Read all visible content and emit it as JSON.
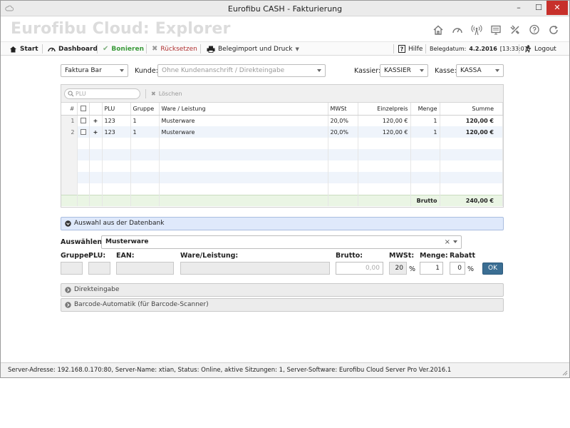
{
  "window": {
    "title": "Eurofibu CASH - Fakturierung",
    "min": "–",
    "max": "☐",
    "close": "✕"
  },
  "header": {
    "brand": "Eurofibu Cloud: Explorer"
  },
  "toolbar": {
    "start": "Start",
    "dashboard": "Dashboard",
    "bonieren": "Bonieren",
    "ruecksetzen": "Rücksetzen",
    "belegimport": "Belegimport und Druck",
    "hilfe": "Hilfe",
    "belegdatum_label": "Belegdatum:",
    "belegdatum_date": "4.2.2016",
    "belegdatum_time": "[13:33:07]",
    "logout": "Logout"
  },
  "form": {
    "type_value": "Faktura Bar",
    "kunde_label": "Kunde:",
    "kunde_placeholder": "Ohne Kundenanschrift / Direkteingabe",
    "kassier_label": "Kassier:",
    "kassier_value": "KASSIER",
    "kasse_label": "Kasse:",
    "kasse_value": "KASSA"
  },
  "grid": {
    "search_placeholder": "PLU",
    "clear_label": "Löschen",
    "columns": [
      "#",
      "",
      "PLU",
      "Gruppe",
      "Ware / Leistung",
      "MWSt",
      "Einzelpreis",
      "Menge",
      "Summe"
    ],
    "rows": [
      {
        "num": "1",
        "plus": "+",
        "plu": "123",
        "gruppe": "1",
        "ware": "Musterware",
        "mwst": "20,0%",
        "einzelpreis": "120,00 €",
        "menge": "1",
        "summe": "120,00 €"
      },
      {
        "num": "2",
        "plus": "+",
        "plu": "123",
        "gruppe": "1",
        "ware": "Musterware",
        "mwst": "20,0%",
        "einzelpreis": "120,00 €",
        "menge": "1",
        "summe": "120,00 €"
      }
    ],
    "footer_label": "Brutto",
    "footer_total": "240,00 €"
  },
  "selection": {
    "panel_title": "Auswahl aus der Datenbank",
    "auswaehlen_label": "Auswählen:",
    "auswaehlen_value": "Musterware",
    "gruppe_label": "Gruppe:",
    "plu_label": "PLU:",
    "ean_label": "EAN:",
    "ware_label": "Ware/Leistung:",
    "brutto_label": "Brutto:",
    "brutto_placeholder": "0,00",
    "mwst_label": "MWSt:",
    "mwst_value": "20",
    "menge_label": "Menge:",
    "menge_value": "1",
    "rabatt_label": "Rabatt",
    "rabatt_value": "0",
    "percent": "%",
    "ok_label": "OK"
  },
  "panels": {
    "direkteingabe": "Direkteingabe",
    "barcode": "Barcode-Automatik (für Barcode-Scanner)"
  },
  "status": {
    "text": "Server-Adresse: 192.168.0.170:80, Server-Name: xtian, Status: Online, aktive Sitzungen: 1, Server-Software: Eurofibu Cloud Server Pro Ver.2016.1"
  },
  "colors": {
    "accent": "#3b6e93",
    "green": "#3a9a3a",
    "red": "#b03030",
    "panel_blue": "#dfe9fb",
    "close": "#c7302b"
  }
}
